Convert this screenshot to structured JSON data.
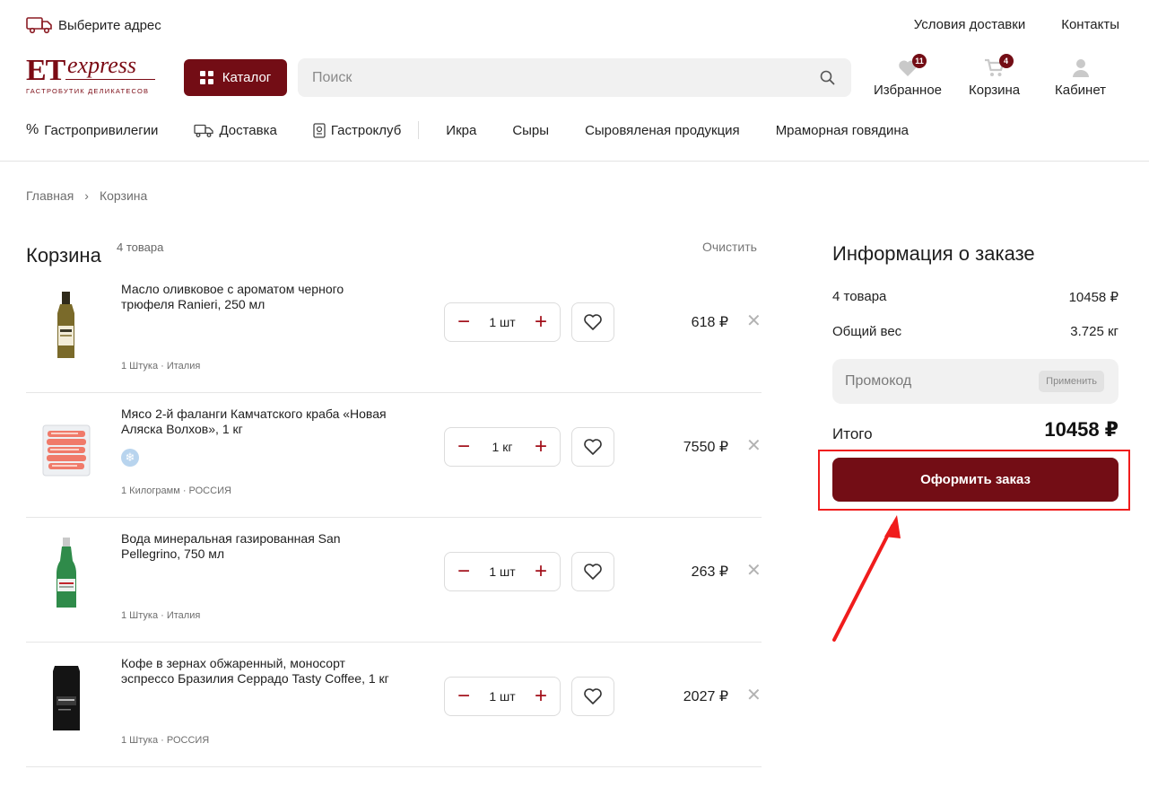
{
  "topbar": {
    "address_label": "Выберите адрес",
    "links": [
      "Условия доставки",
      "Контакты"
    ]
  },
  "logo": {
    "main": "ET",
    "script": "express",
    "tagline": "ГАСТРОБУТИК ДЕЛИКАТЕСОВ"
  },
  "header": {
    "catalog_label": "Каталог",
    "search_placeholder": "Поиск",
    "favorites": {
      "label": "Избранное",
      "count": "11"
    },
    "cart": {
      "label": "Корзина",
      "count": "4"
    },
    "account": {
      "label": "Кабинет"
    }
  },
  "nav": {
    "privileges": "Гастропривилегии",
    "delivery": "Доставка",
    "club": "Гастроклуб",
    "categories": [
      "Икра",
      "Сыры",
      "Сыровяленая продукция",
      "Мраморная говядина"
    ]
  },
  "breadcrumb": {
    "home": "Главная",
    "separator": "›",
    "current": "Корзина"
  },
  "cart": {
    "title": "Корзина",
    "count": "4 товара",
    "clear_label": "Очистить",
    "items": [
      {
        "name": "Масло оливковое с ароматом черного трюфеля Ranieri, 250 мл",
        "meta": "1 Штука · Италия",
        "qty": "1 шт",
        "price": "618 ₽",
        "frozen": false,
        "image": "olive-oil-bottle"
      },
      {
        "name": "Мясо 2-й фаланги Камчатского краба «Новая Аляска Волхов», 1 кг",
        "meta": "1 Килограмм · РОССИЯ",
        "qty": "1 кг",
        "price": "7550 ₽",
        "frozen": true,
        "image": "crab-meat-pack"
      },
      {
        "name": "Вода минеральная газированная San Pellegrino, 750 мл",
        "meta": "1 Штука · Италия",
        "qty": "1 шт",
        "price": "263 ₽",
        "frozen": false,
        "image": "water-bottle"
      },
      {
        "name": "Кофе в зернах обжаренный, моносорт эспрессо Бразилия Серрадо Tasty Coffee, 1 кг",
        "meta": "1 Штука · РОССИЯ",
        "qty": "1 шт",
        "price": "2027 ₽",
        "frozen": false,
        "image": "coffee-bag"
      }
    ],
    "minus_symbol": "−",
    "plus_symbol": "+",
    "remove_symbol": "✕"
  },
  "order_info": {
    "title": "Информация о заказе",
    "items_label": "4 товара",
    "items_total": "10458 ₽",
    "weight_label": "Общий вес",
    "weight_value": "3.725 кг",
    "promo_placeholder": "Промокод",
    "apply_label": "Применить",
    "total_label": "Итого",
    "total_value": "10458 ₽",
    "checkout_label": "Оформить заказ"
  },
  "colors": {
    "brand": "#730d15",
    "accent_red": "#a20e19",
    "highlight": "#f01c1c"
  }
}
